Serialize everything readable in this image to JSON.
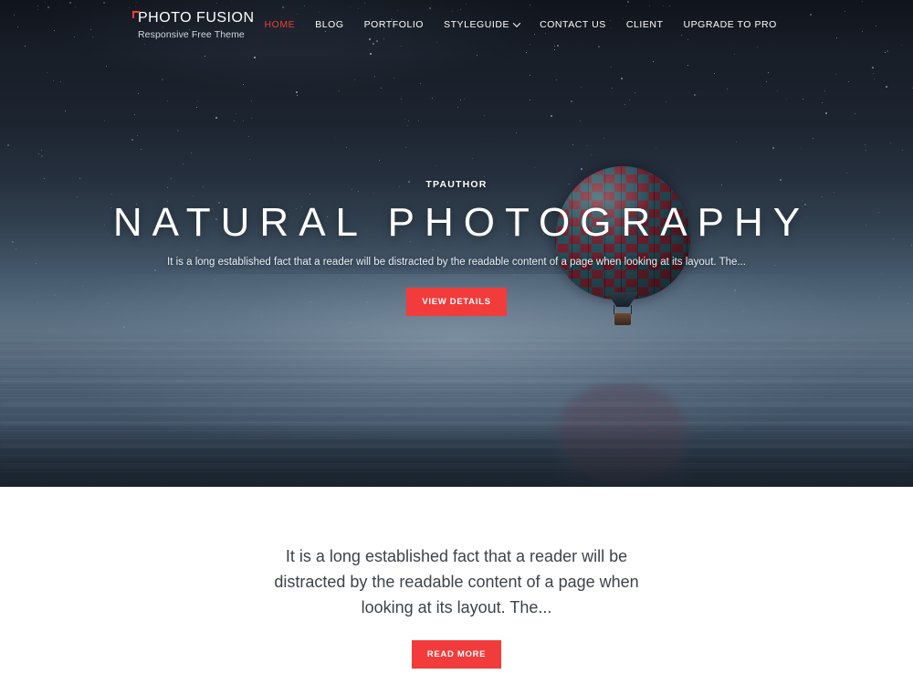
{
  "brand": {
    "title": "PHOTO FUSION",
    "tagline": "Responsive Free Theme",
    "accent_color": "#ef3e36",
    "corner_mark_icon": "corner-bracket-icon"
  },
  "nav": {
    "items": [
      {
        "label": "HOME",
        "active": true
      },
      {
        "label": "BLOG",
        "active": false
      },
      {
        "label": "PORTFOLIO",
        "active": false
      },
      {
        "label": "STYLEGUIDE",
        "active": false,
        "icon": "chevron-down-icon",
        "has_dropdown": true
      },
      {
        "label": "CONTACT US",
        "active": false
      },
      {
        "label": "CLIENT",
        "active": false
      },
      {
        "label": "UPGRADE TO PRO",
        "active": false
      }
    ]
  },
  "hero": {
    "eyebrow": "TPAUTHOR",
    "title": "NATURAL PHOTOGRAPHY",
    "description": "It is a long established fact that a reader will be distracted by the readable content of a page when looking at its layout. The...",
    "button_label": "VIEW DETAILS",
    "button_color": "#f23b3b",
    "image_subject": "hot-air-balloon-over-water-at-night"
  },
  "intro": {
    "text": "It is a long established fact that a reader will be distracted by the readable content of a page when looking at its layout. The...",
    "button_label": "READ MORE",
    "button_color": "#f23b3b"
  }
}
